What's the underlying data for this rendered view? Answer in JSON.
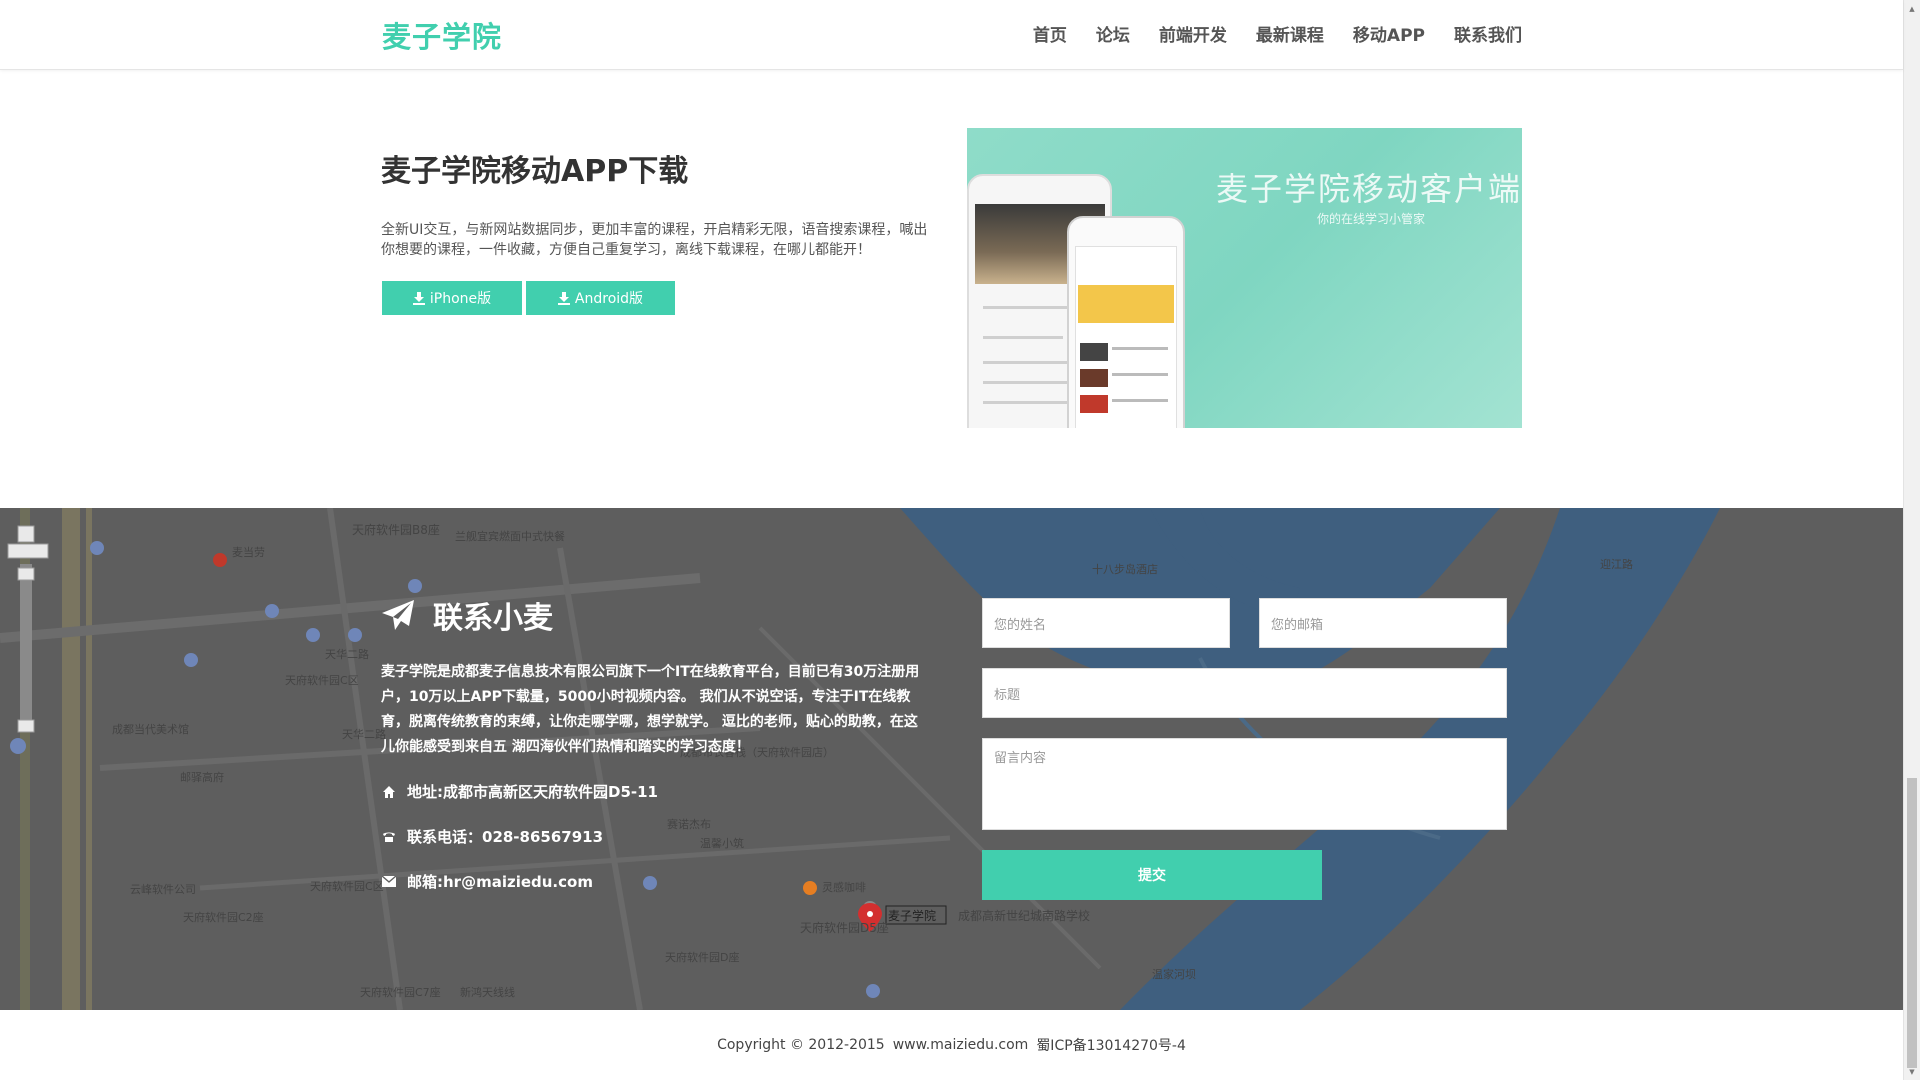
{
  "header": {
    "logo": "麦子学院",
    "nav": [
      "首页",
      "论坛",
      "前端开发",
      "最新课程",
      "移动APP",
      "联系我们"
    ]
  },
  "app_section": {
    "title": "麦子学院移动APP下载",
    "description": "全新UI交互，与新网站数据同步，更加丰富的课程，开启精彩无限，语音搜索课程，喊出你想要的课程，一件收藏，方便自己重复学习，离线下载课程，在哪儿都能开！",
    "iphone_button": "iPhone版",
    "android_button": "Android版",
    "promo_title": "麦子学院移动客户端",
    "promo_subtitle": "你的在线学习小管家"
  },
  "contact": {
    "title": "联系小麦",
    "description": "麦子学院是成都麦子信息技术有限公司旗下一个IT在线教育平台，目前已有30万注册用户，10万以上APP下载量，5000小时视频内容。 我们从不说空话，专注于IT在线教育，脱离传统教育的束缚，让你走哪学哪，想学就学。 逗比的老师，贴心的助教，在这儿你能感受到来自五 湖四海伙伴们热情和踏实的学习态度！",
    "address": "地址:成都市高新区天府软件园D5-11",
    "phone": "联系电话：028-86567913",
    "email": "邮箱:hr@maiziedu.com",
    "form": {
      "name_placeholder": "您的姓名",
      "email_placeholder": "您的邮箱",
      "subject_placeholder": "标题",
      "message_placeholder": "留言内容",
      "submit_label": "提交"
    },
    "map_labels": {
      "a": "天府软件园B8座",
      "b": "兰舰宜宾燃面中式快餐",
      "c": "麦当劳",
      "d": "天府软件园C区",
      "e": "天华二路",
      "f": "成都当代美术馆",
      "g": "天府大道",
      "h": "天华二路",
      "i": "成都布衣客栈（天府软件园店）",
      "j": "邮驿高府",
      "k": "赛诺杰布",
      "l": "温馨小筑",
      "m": "天府软件园C区",
      "n": "云峰软件公司",
      "o": "天府软件园C2座",
      "p": "灵感咖啡",
      "q": "天府软件园D5座",
      "r": "麦子学院",
      "s": "成都高新世纪城南路学校",
      "t": "天府软件园D座",
      "u": "十八步岛酒店",
      "v": "迎江路",
      "w": "温家河坝",
      "x": "天府软件园C7座",
      "y": "新鸿天线线",
      "z": "天府大道"
    }
  },
  "footer": {
    "copyright": "Copyright © 2012-2015",
    "site": "www.maiziedu.com",
    "icp": "蜀ICP备13014270号-4"
  },
  "colors": {
    "accent": "#41cfae",
    "map_background": "#5e5e5e",
    "river": "#3f5f7f"
  }
}
